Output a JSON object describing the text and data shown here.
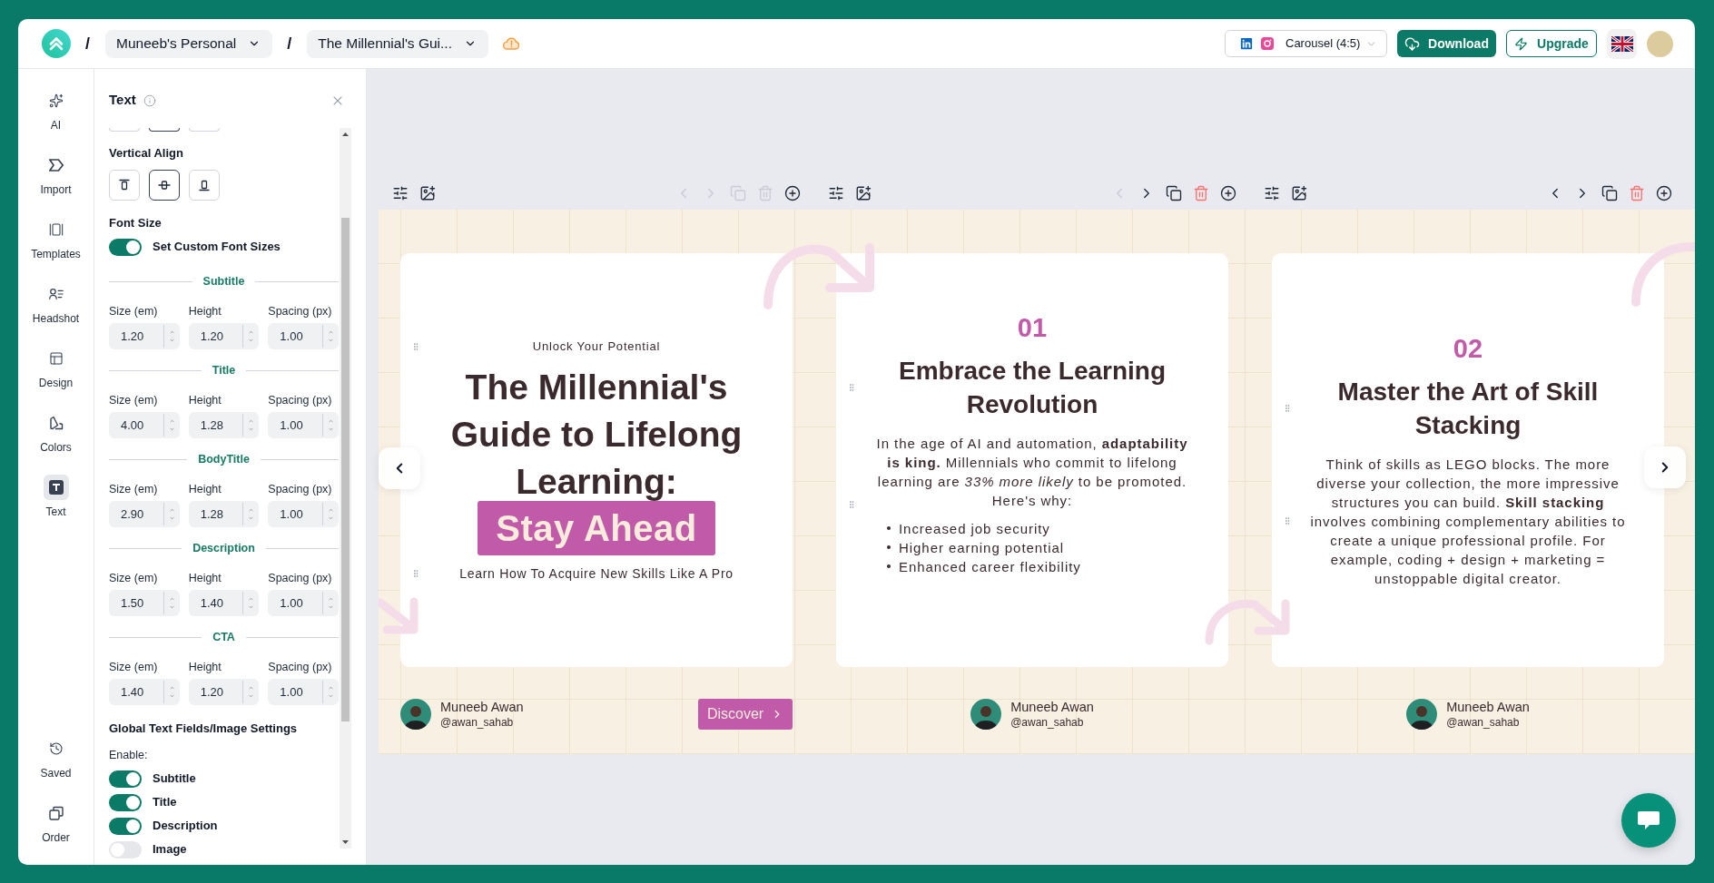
{
  "header": {
    "breadcrumb": [
      {
        "kind": "separator",
        "text": "/"
      },
      {
        "kind": "menu",
        "text": "Muneeb's Personal"
      },
      {
        "kind": "separator",
        "text": "/"
      },
      {
        "kind": "menu",
        "text": "The Millennial's Gui..."
      }
    ],
    "format": "Carousel (4:5)",
    "actions": [
      {
        "label": "Download",
        "kind": "primary"
      },
      {
        "label": "Upgrade",
        "kind": "outline"
      }
    ]
  },
  "rail": {
    "top": [
      {
        "label": "AI",
        "selected": false
      },
      {
        "label": "Import",
        "selected": false
      },
      {
        "label": "Templates",
        "selected": false
      },
      {
        "label": "Headshot",
        "selected": false
      },
      {
        "label": "Design",
        "selected": false
      },
      {
        "label": "Colors",
        "selected": false
      },
      {
        "label": "Text",
        "selected": true
      }
    ],
    "bottom": [
      {
        "label": "Saved",
        "selected": false
      },
      {
        "label": "Order",
        "selected": false
      }
    ]
  },
  "panel": {
    "title": "Text",
    "partial_options": [
      {
        "selected": false
      },
      {
        "selected": true
      },
      {
        "selected": false
      }
    ],
    "vertical_align": {
      "label": "Vertical Align",
      "options": [
        {
          "selected": false
        },
        {
          "selected": true
        },
        {
          "selected": false
        }
      ]
    },
    "font_size": {
      "label": "Font Size",
      "custom_toggle": {
        "label": "Set Custom Font Sizes",
        "on": true
      },
      "groups": [
        {
          "name": "Subtitle",
          "fields": [
            {
              "label": "Size (em)",
              "value": "1.20"
            },
            {
              "label": "Height",
              "value": "1.20"
            },
            {
              "label": "Spacing (px)",
              "value": "1.00"
            }
          ]
        },
        {
          "name": "Title",
          "fields": [
            {
              "label": "Size (em)",
              "value": "4.00"
            },
            {
              "label": "Height",
              "value": "1.28"
            },
            {
              "label": "Spacing (px)",
              "value": "1.00"
            }
          ]
        },
        {
          "name": "BodyTitle",
          "fields": [
            {
              "label": "Size (em)",
              "value": "2.90"
            },
            {
              "label": "Height",
              "value": "1.28"
            },
            {
              "label": "Spacing (px)",
              "value": "1.00"
            }
          ]
        },
        {
          "name": "Description",
          "fields": [
            {
              "label": "Size (em)",
              "value": "1.50"
            },
            {
              "label": "Height",
              "value": "1.40"
            },
            {
              "label": "Spacing (px)",
              "value": "1.00"
            }
          ]
        },
        {
          "name": "CTA",
          "fields": [
            {
              "label": "Size (em)",
              "value": "1.40"
            },
            {
              "label": "Height",
              "value": "1.20"
            },
            {
              "label": "Spacing (px)",
              "value": "1.00"
            }
          ]
        }
      ]
    },
    "global_settings": {
      "title": "Global Text Fields/Image Settings",
      "enable_label": "Enable:",
      "toggles": [
        {
          "label": "Subtitle",
          "on": true
        },
        {
          "label": "Title",
          "on": true
        },
        {
          "label": "Description",
          "on": true
        },
        {
          "label": "Image",
          "on": false
        }
      ]
    }
  },
  "slides": [
    {
      "kind": "cover",
      "toolbar": {
        "prev_disabled": true,
        "next_disabled": true,
        "copy_disabled": true,
        "delete_disabled": true
      },
      "subtitle": "Unlock Your Potential",
      "title": "The Millennial's Guide to Lifelong Learning:",
      "highlight": "Stay Ahead",
      "description": "Learn How To Acquire New Skills Like A Pro",
      "author": {
        "name": "Muneeb Awan",
        "handle": "@awan_sahab"
      },
      "cta": "Discover"
    },
    {
      "kind": "point",
      "toolbar": {
        "prev_disabled": true,
        "next_disabled": false,
        "copy_disabled": false,
        "delete_disabled": false
      },
      "number": "01",
      "title": "Embrace the Learning Revolution",
      "body": "In the age of AI and automation, **adaptability is king.** Millennials who commit to lifelong learning are *33% more likely* to be promoted. Here's why:",
      "bullets": [
        "Increased job security",
        "Higher earning potential",
        "Enhanced career flexibility"
      ],
      "author": {
        "name": "Muneeb Awan",
        "handle": "@awan_sahab"
      }
    },
    {
      "kind": "point",
      "toolbar": {
        "prev_disabled": false,
        "next_disabled": false,
        "copy_disabled": false,
        "delete_disabled": false
      },
      "number": "02",
      "title": "Master the Art of Skill Stacking",
      "body": "Think of skills as LEGO blocks. The more diverse your collection, the more impressive structures you can build. **Skill stacking** involves combining complementary abilities to create a unique professional profile. For example, coding + design + marketing = unstoppable digital creator.",
      "author": {
        "name": "Muneeb Awan",
        "handle": "@awan_sahab"
      }
    }
  ]
}
